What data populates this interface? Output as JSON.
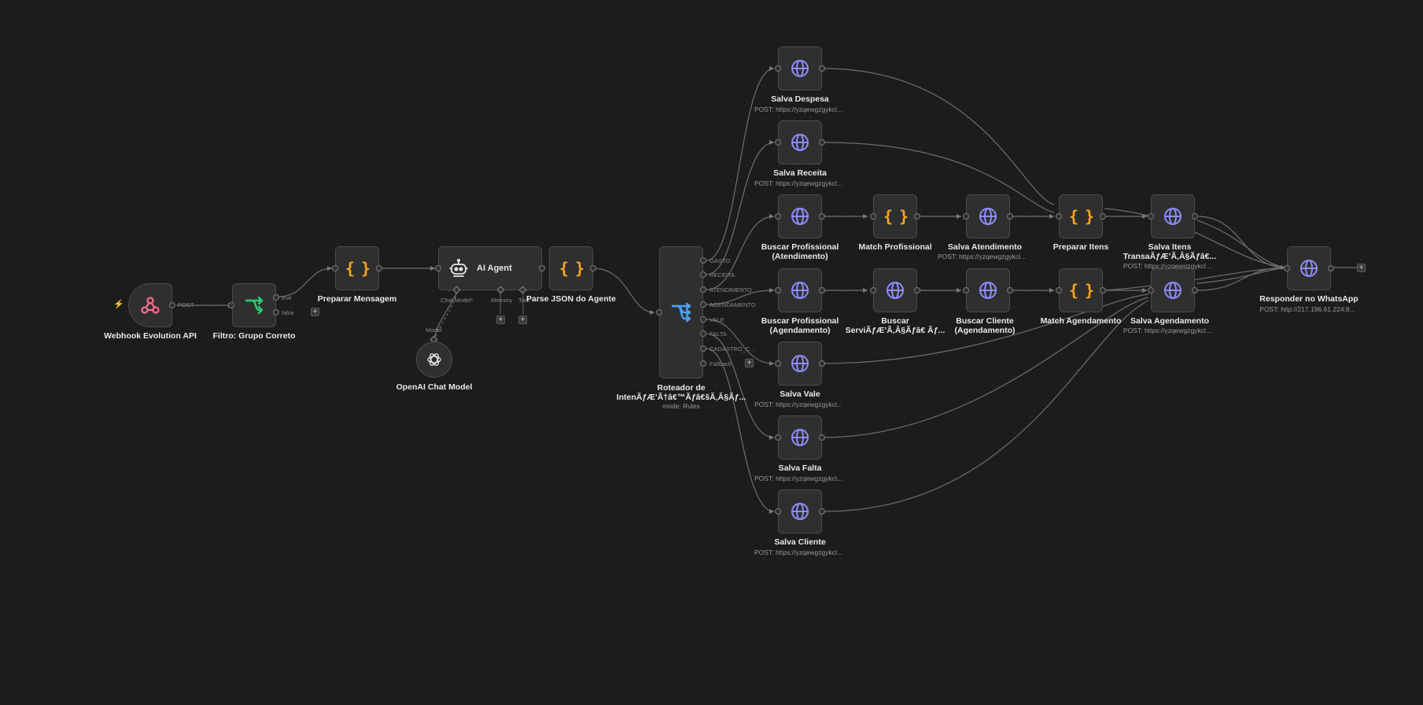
{
  "colors": {
    "background": "#1c1c1c",
    "node_bg": "#2f2f2f",
    "wire": "#6f6f6f",
    "http_icon": "#8f8cff",
    "code_icon": "#f5a623",
    "webhook_icon": "#ff6d8d",
    "filter_icon": "#2ecc71",
    "router_icon": "#4aa3ff"
  },
  "nodes": {
    "webhook": {
      "label": "Webhook Evolution API",
      "port_post": "POST",
      "icon": "webhook-icon"
    },
    "filter": {
      "label": "Filtro: Grupo Correto",
      "port_true": "true",
      "port_false": "false",
      "icon": "branch-icon"
    },
    "preparar_mensagem": {
      "label": "Preparar Mensagem",
      "icon": "code-braces-icon"
    },
    "ai_agent": {
      "label": "AI Agent",
      "port_chat_model": "Chat Model",
      "required_mark": "*",
      "port_memory": "Memory",
      "port_tool": "Tool",
      "icon": "robot-icon"
    },
    "openai": {
      "label": "OpenAI Chat Model",
      "port_model": "Model",
      "icon": "openai-icon"
    },
    "parse_json": {
      "label": "Parse JSON do Agente",
      "icon": "code-braces-icon"
    },
    "roteador": {
      "label_line1": "Roteador de",
      "label_line2": "IntenÃƒÆ’Ã†â€™Ãƒâ€šÃ‚Â§Ãƒ...",
      "sub": "mode: Rules",
      "outputs": [
        "GASTO",
        "RECEITA",
        "ATENDIMENTO",
        "AGENDAMENTO",
        "VALE",
        "FALTA",
        "CADASTRO_C...",
        "Fallback"
      ],
      "icon": "router-icon"
    },
    "salva_despesa": {
      "label": "Salva Despesa",
      "sub": "POST: https://yzqewgzgykcl...",
      "icon": "globe-icon"
    },
    "salva_receita": {
      "label": "Salva Receita",
      "sub": "POST: https://yzqewgzgykcl...",
      "icon": "globe-icon"
    },
    "buscar_prof_atend": {
      "label_line1": "Buscar Profissional",
      "label_line2": "(Atendimento)",
      "icon": "globe-icon"
    },
    "match_profissional": {
      "label": "Match Profissional",
      "icon": "code-braces-icon"
    },
    "salva_atendimento": {
      "label": "Salva Atendimento",
      "sub": "POST: https://yzqewgzgykcl...",
      "icon": "globe-icon"
    },
    "preparar_itens": {
      "label": "Preparar Itens",
      "icon": "code-braces-icon"
    },
    "salva_itens": {
      "label_line1": "Salva Itens",
      "label_line2": "TransaÃƒÆ’Ã‚Â§Ãƒâ€...",
      "sub": "POST: https://yzqewgzgykcl...",
      "icon": "globe-icon"
    },
    "buscar_prof_agend": {
      "label_line1": "Buscar Profissional",
      "label_line2": "(Agendamento)",
      "icon": "globe-icon"
    },
    "buscar_servico": {
      "label_line1": "Buscar",
      "label_line2": "ServiÃƒÆ’Ã‚Â§Ãƒâ€ Ãƒ...",
      "icon": "globe-icon"
    },
    "buscar_cliente": {
      "label_line1": "Buscar Cliente",
      "label_line2": "(Agendamento)",
      "icon": "globe-icon"
    },
    "match_agendamento": {
      "label": "Match Agendamento",
      "icon": "code-braces-icon"
    },
    "salva_agendamento": {
      "label": "Salva Agendamento",
      "sub": "POST: https://yzqewgzgykcl...",
      "icon": "globe-icon"
    },
    "salva_vale": {
      "label": "Salva Vale",
      "sub": "POST: https://yzqewgzgykcl...",
      "icon": "globe-icon"
    },
    "salva_falta": {
      "label": "Salva Falta",
      "sub": "POST: https://yzqewgzgykcl...",
      "icon": "globe-icon"
    },
    "salva_cliente": {
      "label": "Salva Cliente",
      "sub": "POST: https://yzqewgzgykcl...",
      "icon": "globe-icon"
    },
    "responder": {
      "label": "Responder no WhatsApp",
      "sub": "POST: http://217.196.61.224:8...",
      "icon": "globe-icon"
    }
  },
  "plus_label": "+"
}
